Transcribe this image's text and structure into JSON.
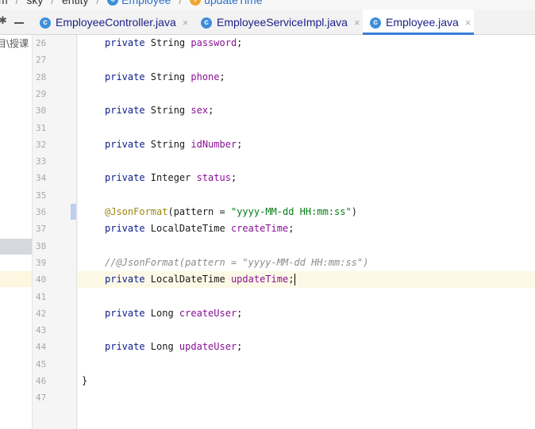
{
  "breadcrumb": {
    "items": [
      "m",
      "sky",
      "entity",
      "Employee",
      "updateTime"
    ],
    "separator": "/"
  },
  "tabs": [
    {
      "label": "EmployeeController.java",
      "active": false,
      "icon": "class-icon"
    },
    {
      "label": "EmployeeServiceImpl.java",
      "active": false,
      "icon": "class-icon"
    },
    {
      "label": "Employee.java",
      "active": true,
      "icon": "class-icon"
    }
  ],
  "tab_close_glyph": "×",
  "class_icon_letter": "c",
  "field_icon_letter": "f",
  "project_tree": {
    "truncated_text": "目\\授课"
  },
  "editor": {
    "lines": [
      {
        "n": "26",
        "tokens": [
          {
            "t": "private ",
            "c": "kw"
          },
          {
            "t": "String ",
            "c": ""
          },
          {
            "t": "password",
            "c": "fld"
          },
          {
            "t": ";",
            "c": ""
          }
        ]
      },
      {
        "n": "27",
        "tokens": []
      },
      {
        "n": "28",
        "tokens": [
          {
            "t": "private ",
            "c": "kw"
          },
          {
            "t": "String ",
            "c": ""
          },
          {
            "t": "phone",
            "c": "fld"
          },
          {
            "t": ";",
            "c": ""
          }
        ]
      },
      {
        "n": "29",
        "tokens": []
      },
      {
        "n": "30",
        "tokens": [
          {
            "t": "private ",
            "c": "kw"
          },
          {
            "t": "String ",
            "c": ""
          },
          {
            "t": "sex",
            "c": "fld"
          },
          {
            "t": ";",
            "c": ""
          }
        ]
      },
      {
        "n": "31",
        "tokens": []
      },
      {
        "n": "32",
        "tokens": [
          {
            "t": "private ",
            "c": "kw"
          },
          {
            "t": "String ",
            "c": ""
          },
          {
            "t": "idNumber",
            "c": "fld"
          },
          {
            "t": ";",
            "c": ""
          }
        ]
      },
      {
        "n": "33",
        "tokens": []
      },
      {
        "n": "34",
        "tokens": [
          {
            "t": "private ",
            "c": "kw"
          },
          {
            "t": "Integer ",
            "c": ""
          },
          {
            "t": "status",
            "c": "fld"
          },
          {
            "t": ";",
            "c": ""
          }
        ]
      },
      {
        "n": "35",
        "tokens": []
      },
      {
        "n": "36",
        "tokens": [
          {
            "t": "@JsonFormat",
            "c": "ann"
          },
          {
            "t": "(pattern = ",
            "c": ""
          },
          {
            "t": "\"yyyy-MM-dd HH:mm:ss\"",
            "c": "str"
          },
          {
            "t": ")",
            "c": ""
          }
        ]
      },
      {
        "n": "37",
        "tokens": [
          {
            "t": "private ",
            "c": "kw"
          },
          {
            "t": "LocalDateTime ",
            "c": ""
          },
          {
            "t": "createTime",
            "c": "fld"
          },
          {
            "t": ";",
            "c": ""
          }
        ]
      },
      {
        "n": "38",
        "tokens": []
      },
      {
        "n": "39",
        "tokens": [
          {
            "t": "//@JsonFormat(pattern = \"yyyy-MM-dd HH:mm:ss\")",
            "c": "cmt"
          }
        ]
      },
      {
        "n": "40",
        "tokens": [
          {
            "t": "private ",
            "c": "kw"
          },
          {
            "t": "LocalDateTime ",
            "c": ""
          },
          {
            "t": "updateTime",
            "c": "fld"
          },
          {
            "t": ";",
            "c": ""
          }
        ],
        "caret": true
      },
      {
        "n": "41",
        "tokens": []
      },
      {
        "n": "42",
        "tokens": [
          {
            "t": "private ",
            "c": "kw"
          },
          {
            "t": "Long ",
            "c": ""
          },
          {
            "t": "createUser",
            "c": "fld"
          },
          {
            "t": ";",
            "c": ""
          }
        ]
      },
      {
        "n": "43",
        "tokens": []
      },
      {
        "n": "44",
        "tokens": [
          {
            "t": "private ",
            "c": "kw"
          },
          {
            "t": "Long ",
            "c": ""
          },
          {
            "t": "updateUser",
            "c": "fld"
          },
          {
            "t": ";",
            "c": ""
          }
        ]
      },
      {
        "n": "45",
        "tokens": []
      },
      {
        "n": "46",
        "tokens": [
          {
            "t": "}",
            "c": ""
          }
        ],
        "outdent": true
      },
      {
        "n": "47",
        "tokens": []
      }
    ]
  },
  "colors": {
    "keyword": "#0a1b8a",
    "field": "#871094",
    "annotation": "#9e880d",
    "string": "#067d17",
    "comment": "#8c8c8c",
    "active_tab_underline": "#3a7bd5"
  }
}
